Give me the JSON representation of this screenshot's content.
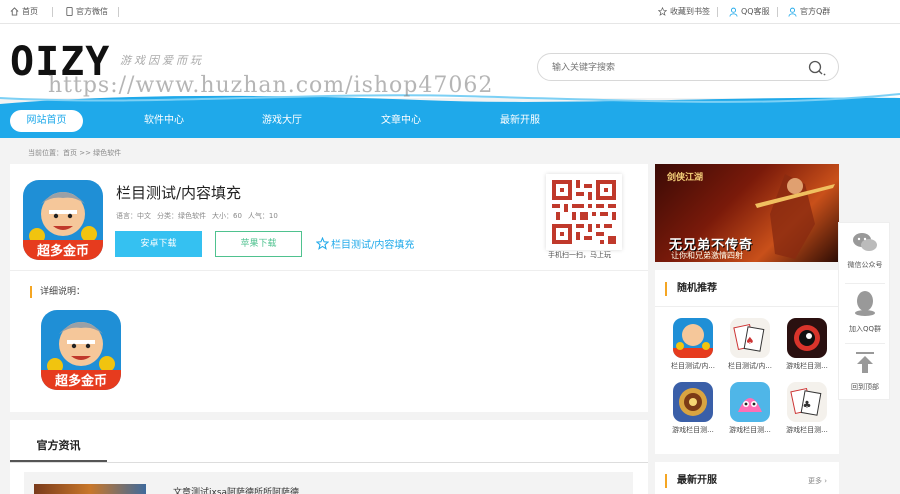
{
  "topbar": {
    "home": "首页",
    "wechat": "官方微信",
    "bookmark": "收藏到书签",
    "qq_service": "QQ客服",
    "qq_group": "官方Q群"
  },
  "header": {
    "logo": "OIZY",
    "logo_sub": "游戏因爱而玩",
    "search_placeholder": "输入关键字搜索"
  },
  "watermark": "https://www.huzhan.com/ishop47062",
  "nav": {
    "items": [
      "网站首页",
      "软件中心",
      "游戏大厅",
      "文章中心",
      "最新开服"
    ]
  },
  "breadcrumb": "当前位置：首页 >> 绿色软件",
  "app": {
    "icon_badge": "超多金币",
    "title": "栏目测试/内容填充",
    "language": "语言：中文",
    "category": "分类：绿色软件",
    "size": "大小：60",
    "popularity": "人气：10",
    "android_btn": "安卓下载",
    "apple_btn": "苹果下载",
    "favorite": "栏目测试/内容填充",
    "qr_caption": "手机扫一扫，马上玩",
    "detail_label": "详细说明："
  },
  "news": {
    "tab": "官方资讯",
    "first_title": "文章测试ixsa阿萨德所所阿萨德"
  },
  "banner": {
    "top": "剑侠江湖",
    "main": "无兄弟不传奇",
    "sub": "让你和兄弟激情四射"
  },
  "recommend": {
    "title": "随机推荐",
    "items": [
      {
        "label": "栏目测试/内...",
        "icon": "coin-grandpa-icon"
      },
      {
        "label": "栏目测试/内...",
        "icon": "poker-icon"
      },
      {
        "label": "游戏栏目测...",
        "icon": "dark-game-icon"
      },
      {
        "label": "游戏栏目测...",
        "icon": "hearthstone-icon"
      },
      {
        "label": "游戏栏目测...",
        "icon": "pink-creature-icon"
      },
      {
        "label": "游戏栏目测...",
        "icon": "poker-icon"
      }
    ]
  },
  "latest": {
    "title": "最新开服",
    "more": "更多"
  },
  "side": {
    "wechat": "微信公众号",
    "qq": "加入QQ群",
    "top": "回到顶部"
  },
  "colors": {
    "accent": "#1fa9ea",
    "android": "#35c1f1",
    "apple": "#4fc28f",
    "marker": "#f5a623"
  }
}
